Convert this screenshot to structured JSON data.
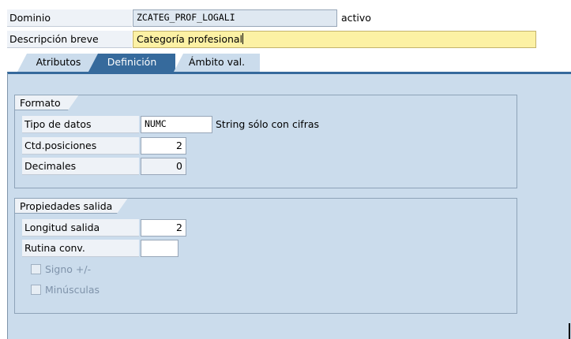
{
  "header": {
    "dominio_label": "Dominio",
    "dominio_value": "ZCATEG_PROF_LOGALI",
    "status": "activo",
    "descripcion_label": "Descripción breve",
    "descripcion_value": "Categoría profesional"
  },
  "tabs": [
    {
      "label": "Atributos",
      "active": false
    },
    {
      "label": "Definición",
      "active": true
    },
    {
      "label": "Ámbito val.",
      "active": false
    }
  ],
  "formato": {
    "title": "Formato",
    "tipo_datos_label": "Tipo de datos",
    "tipo_datos_value": "NUMC",
    "tipo_datos_desc": "String sólo con cifras",
    "posiciones_label": "Ctd.posiciones",
    "posiciones_value": "2",
    "decimales_label": "Decimales",
    "decimales_value": "0"
  },
  "salida": {
    "title": "Propiedades salida",
    "longitud_label": "Longitud salida",
    "longitud_value": "2",
    "rutina_label": "Rutina conv.",
    "rutina_value": "",
    "signo_label": "Signo +/-",
    "signo_checked": false,
    "minusculas_label": "Minúsculas",
    "minusculas_checked": false
  },
  "colors": {
    "active_tab": "#366a9c",
    "panel_bg": "#cbdcec",
    "focused_field_bg": "#fcf1a4"
  }
}
